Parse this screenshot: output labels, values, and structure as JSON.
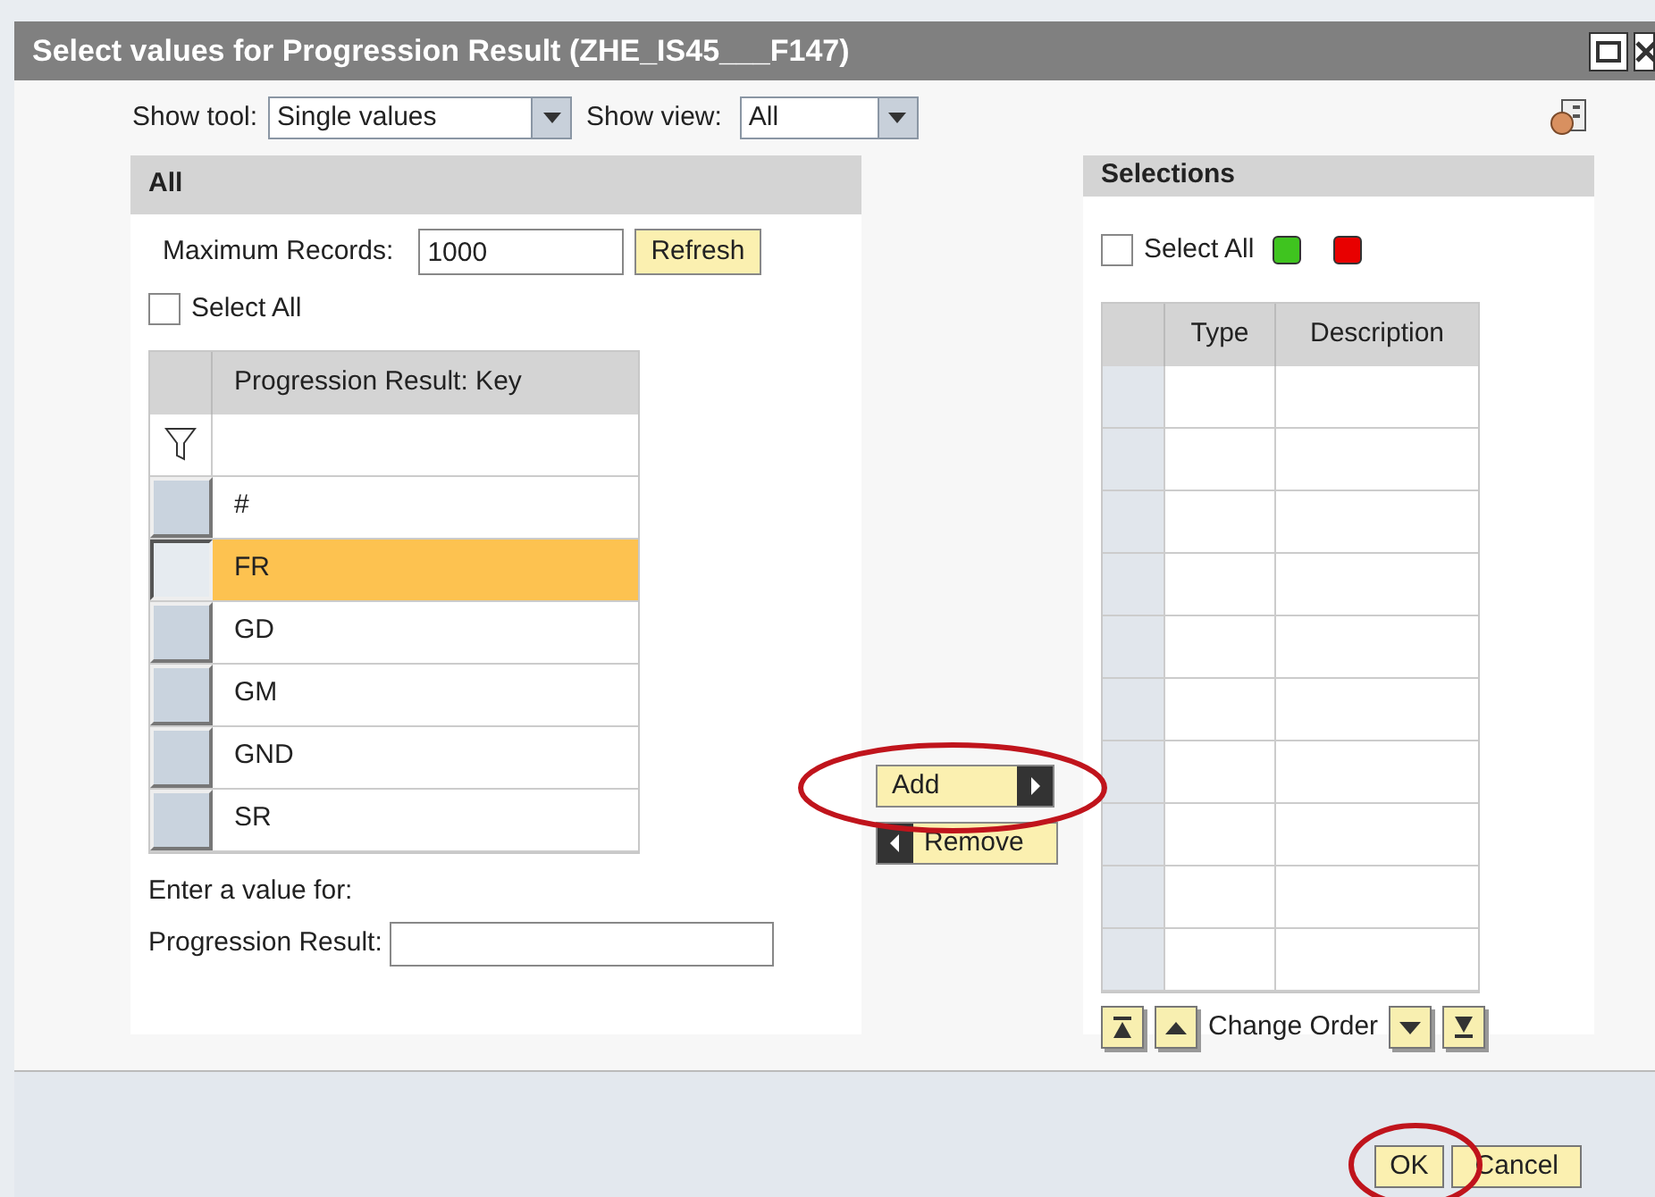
{
  "window": {
    "title": "Select values for Progression Result (ZHE_IS45___F147)"
  },
  "toolbar": {
    "show_tool_label": "Show tool:",
    "show_tool_value": "Single values",
    "show_view_label": "Show view:",
    "show_view_value": "All"
  },
  "all_panel": {
    "title": "All",
    "max_records_label": "Maximum Records:",
    "max_records_value": "1000",
    "refresh_button": "Refresh",
    "select_all": {
      "label": "Select All",
      "checked": false
    },
    "table": {
      "columns": [
        "Progression Result: Key"
      ],
      "rows": [
        {
          "key": "#",
          "selected": false
        },
        {
          "key": "FR",
          "selected": true
        },
        {
          "key": "GD",
          "selected": false
        },
        {
          "key": "GM",
          "selected": false
        },
        {
          "key": "GND",
          "selected": false
        },
        {
          "key": "SR",
          "selected": false
        }
      ]
    },
    "enter_value_label": "Enter a value for:",
    "field_label": "Progression Result:"
  },
  "add_button": "Add",
  "remove_button": "Remove",
  "selections_panel": {
    "title": "Selections",
    "select_all": {
      "label": "Select All",
      "checked": false
    },
    "table": {
      "columns": [
        "Type",
        "Description"
      ],
      "row_count_rows": [
        {},
        {},
        {},
        {},
        {},
        {},
        {},
        {},
        {},
        {}
      ]
    },
    "change_order_label": "Change Order"
  },
  "buttons": [
    "OK",
    "Cancel"
  ]
}
